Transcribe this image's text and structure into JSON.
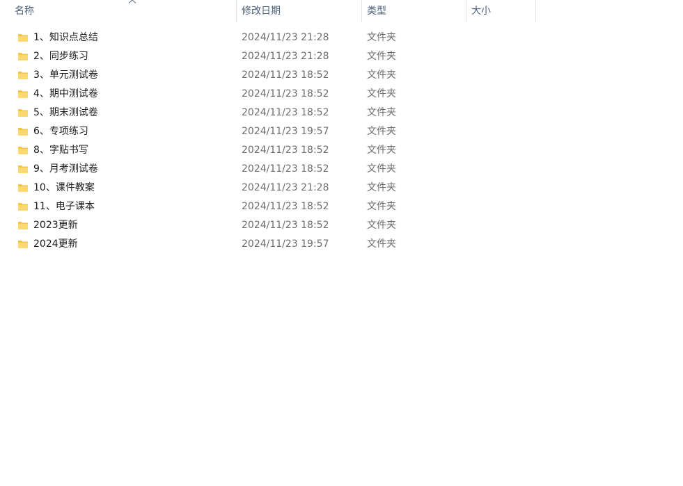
{
  "columns": {
    "name": "名称",
    "date": "修改日期",
    "type": "类型",
    "size": "大小"
  },
  "sort": {
    "column": "name",
    "icon": "chevron-up-icon"
  },
  "colors": {
    "folder_body": "#f6c443",
    "folder_front": "#fcd970",
    "header_text": "#4c607a"
  },
  "files": [
    {
      "name": "1、知识点总结",
      "date": "2024/11/23 21:28",
      "type": "文件夹",
      "size": ""
    },
    {
      "name": "2、同步练习",
      "date": "2024/11/23 21:28",
      "type": "文件夹",
      "size": ""
    },
    {
      "name": "3、单元测试卷",
      "date": "2024/11/23 18:52",
      "type": "文件夹",
      "size": ""
    },
    {
      "name": "4、期中测试卷",
      "date": "2024/11/23 18:52",
      "type": "文件夹",
      "size": ""
    },
    {
      "name": "5、期末测试卷",
      "date": "2024/11/23 18:52",
      "type": "文件夹",
      "size": ""
    },
    {
      "name": "6、专项练习",
      "date": "2024/11/23 19:57",
      "type": "文件夹",
      "size": ""
    },
    {
      "name": "8、字贴书写",
      "date": "2024/11/23 18:52",
      "type": "文件夹",
      "size": ""
    },
    {
      "name": "9、月考测试卷",
      "date": "2024/11/23 18:52",
      "type": "文件夹",
      "size": ""
    },
    {
      "name": "10、课件教案",
      "date": "2024/11/23 21:28",
      "type": "文件夹",
      "size": ""
    },
    {
      "name": "11、电子课本",
      "date": "2024/11/23 18:52",
      "type": "文件夹",
      "size": ""
    },
    {
      "name": "2023更新",
      "date": "2024/11/23 18:52",
      "type": "文件夹",
      "size": ""
    },
    {
      "name": "2024更新",
      "date": "2024/11/23 19:57",
      "type": "文件夹",
      "size": ""
    }
  ]
}
